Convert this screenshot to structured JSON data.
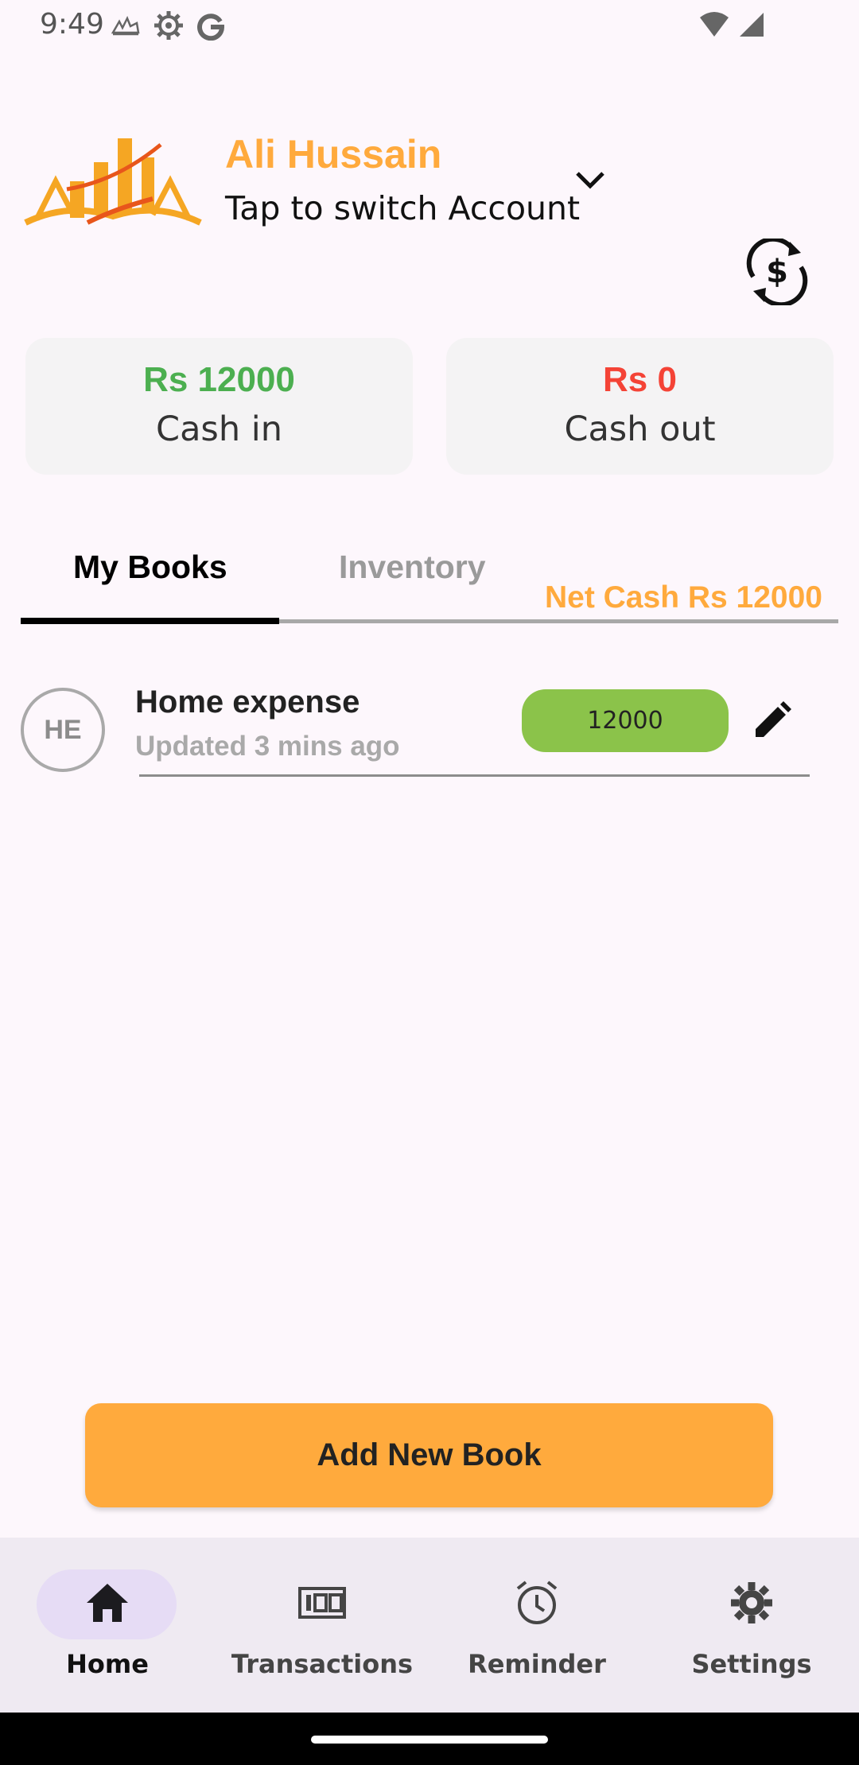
{
  "status_bar": {
    "time": "9:49"
  },
  "account": {
    "name": "Ali Hussain",
    "switch_label": "Tap to switch Account"
  },
  "summary": {
    "cash_in_amount": "Rs 12000",
    "cash_in_label": "Cash in",
    "cash_out_amount": "Rs 0",
    "cash_out_label": "Cash out",
    "cash_in_color": "#4caf50",
    "cash_out_color": "#f44336"
  },
  "tabs": {
    "items": [
      {
        "label": "My Books",
        "active": true
      },
      {
        "label": "Inventory",
        "active": false
      }
    ],
    "net_cash": "Net Cash Rs 12000"
  },
  "books": [
    {
      "initials": "HE",
      "title": "Home expense",
      "updated": "Updated 3 mins ago",
      "amount": "12000"
    }
  ],
  "actions": {
    "add_book_label": "Add New Book"
  },
  "bottom_nav": {
    "items": [
      {
        "label": "Home",
        "icon": "home-icon",
        "active": true
      },
      {
        "label": "Transactions",
        "icon": "money-icon",
        "active": false
      },
      {
        "label": "Reminder",
        "icon": "alarm-icon",
        "active": false
      },
      {
        "label": "Settings",
        "icon": "gear-icon",
        "active": false
      }
    ]
  },
  "colors": {
    "accent": "#ffaa3d",
    "background": "#fdf7fc",
    "amount_badge": "#8bc34a"
  }
}
